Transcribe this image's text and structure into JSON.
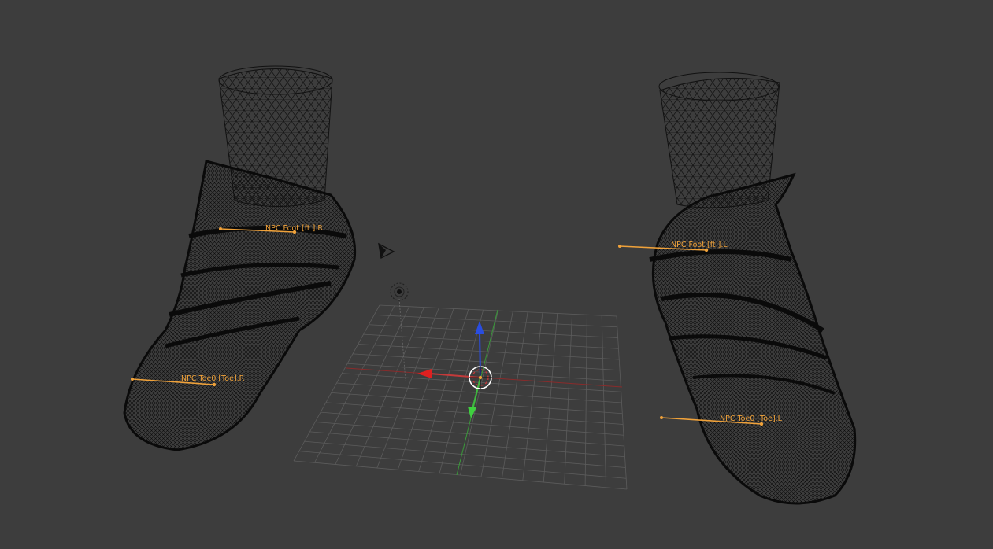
{
  "viewport": {
    "background": "#3d3d3d",
    "grid_color": "#5c5c5c",
    "x_axis_color": "#c33a3a",
    "y_axis_color": "#3fb83f",
    "z_axis_color": "#2a4de0",
    "bone_color": "#f0a23a",
    "mesh_color": "#0a0a0a"
  },
  "bones": {
    "foot_r": "NPC Foot [ft ].R",
    "toe_r": "NPC Toe0 [Toe].R",
    "foot_l": "NPC Foot [ft ].L",
    "toe_l": "NPC Toe0 [Toe].L"
  },
  "objects": {
    "camera": "camera-icon",
    "light": "lamp-icon",
    "cursor": "3d-cursor-icon",
    "gizmo": "transform-gizmo-icon"
  }
}
